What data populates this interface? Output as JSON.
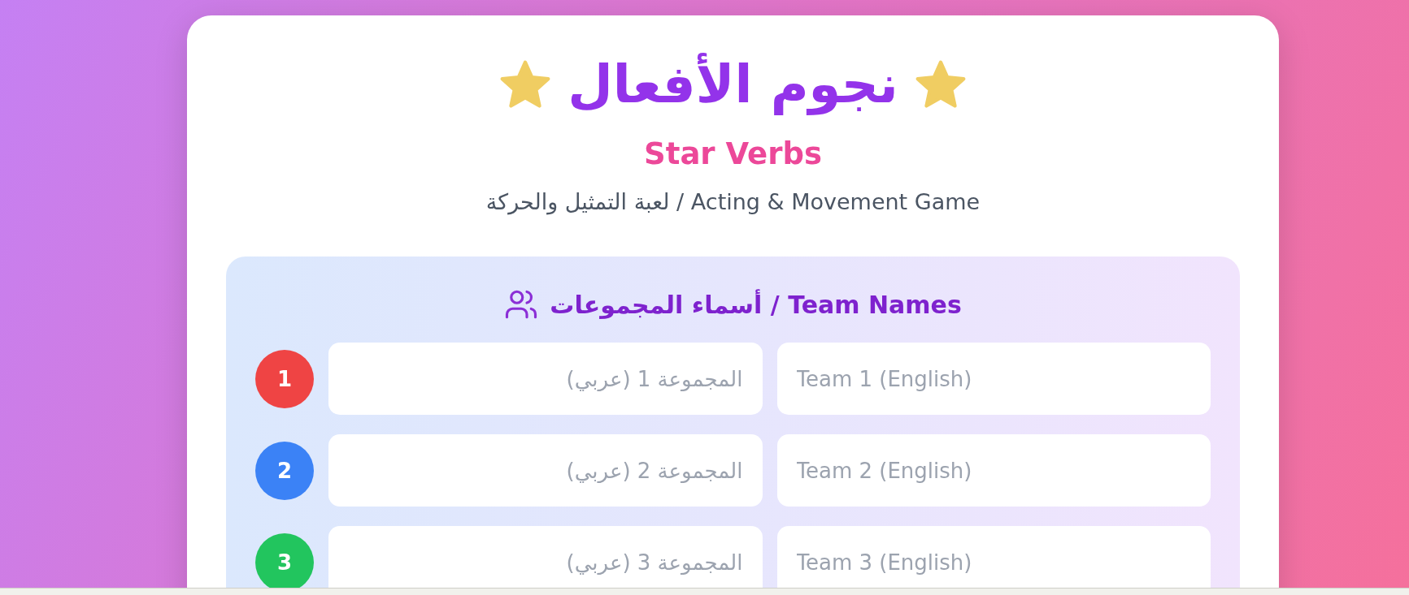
{
  "header": {
    "title": "نجوم الأفعال",
    "subtitle": "Star Verbs",
    "tagline": "لعبة التمثيل والحركة / Acting & Movement Game"
  },
  "teams_panel": {
    "heading": "أسماء المجموعات / Team Names",
    "teams": [
      {
        "number": "1",
        "color": "#ef4444",
        "arabic_placeholder": "المجموعة 1 (عربي)",
        "english_placeholder": "Team 1 (English)"
      },
      {
        "number": "2",
        "color": "#3b82f6",
        "arabic_placeholder": "المجموعة 2 (عربي)",
        "english_placeholder": "Team 2 (English)"
      },
      {
        "number": "3",
        "color": "#22c55e",
        "arabic_placeholder": "المجموعة 3 (عربي)",
        "english_placeholder": "Team 3 (English)"
      }
    ]
  }
}
